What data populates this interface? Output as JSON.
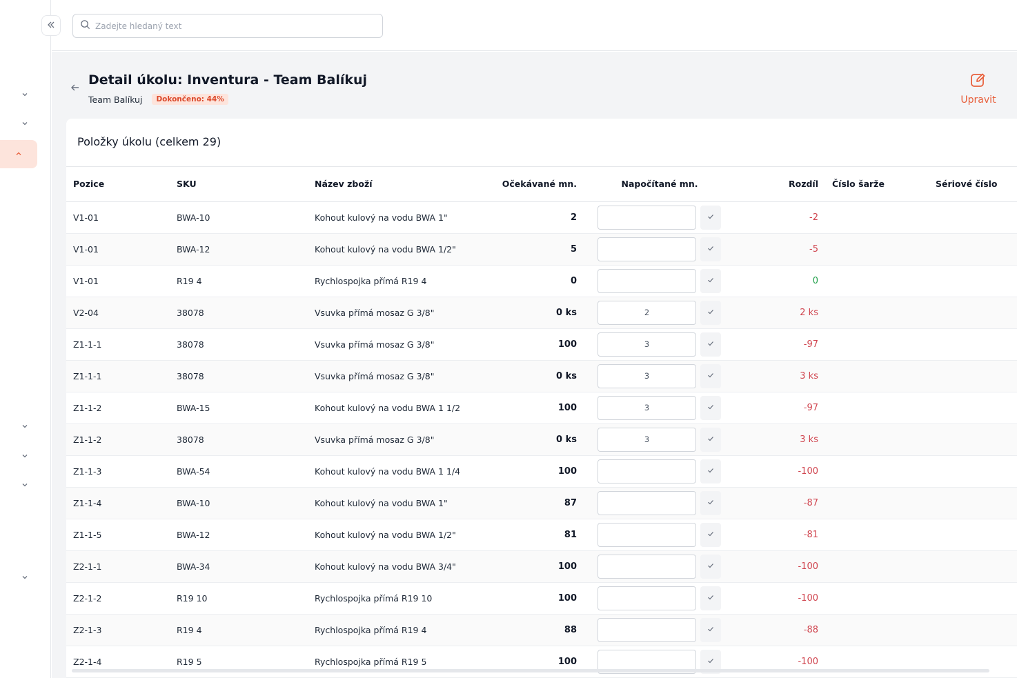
{
  "search": {
    "placeholder": "Zadejte hledaný text"
  },
  "page": {
    "title": "Detail úkolu: Inventura - Team Balíkuj",
    "team": "Team Balíkuj",
    "progress_badge": "Dokončeno: 44%",
    "edit_label": "Upravit"
  },
  "items_card": {
    "title": "Položky úkolu (celkem 29)"
  },
  "table": {
    "headers": {
      "position": "Pozice",
      "sku": "SKU",
      "name": "Název zboží",
      "expected": "Očekávané mn.",
      "counted": "Napočítané mn.",
      "diff": "Rozdíl",
      "batch": "Číslo šarže",
      "serial": "Sériové číslo"
    },
    "rows": [
      {
        "position": "V1-01",
        "sku": "BWA-10",
        "name": "Kohout kulový na vodu BWA 1\"",
        "expected": "2",
        "counted": "",
        "diff": "-2",
        "diff_status": "neg"
      },
      {
        "position": "V1-01",
        "sku": "BWA-12",
        "name": "Kohout kulový na vodu BWA 1/2\"",
        "expected": "5",
        "counted": "",
        "diff": "-5",
        "diff_status": "neg"
      },
      {
        "position": "V1-01",
        "sku": "R19 4",
        "name": "Rychlospojka přímá R19 4",
        "expected": "0",
        "counted": "",
        "diff": "0",
        "diff_status": "zero"
      },
      {
        "position": "V2-04",
        "sku": "38078",
        "name": "Vsuvka přímá mosaz G 3/8\"",
        "expected": "0 ks",
        "counted": "2",
        "diff": "2 ks",
        "diff_status": "neg"
      },
      {
        "position": "Z1-1-1",
        "sku": "38078",
        "name": "Vsuvka přímá mosaz G 3/8\"",
        "expected": "100",
        "counted": "3",
        "diff": "-97",
        "diff_status": "neg"
      },
      {
        "position": "Z1-1-1",
        "sku": "38078",
        "name": "Vsuvka přímá mosaz G 3/8\"",
        "expected": "0 ks",
        "counted": "3",
        "diff": "3 ks",
        "diff_status": "neg"
      },
      {
        "position": "Z1-1-2",
        "sku": "BWA-15",
        "name": "Kohout kulový na vodu BWA 1 1/2\"",
        "expected": "100",
        "counted": "3",
        "diff": "-97",
        "diff_status": "neg"
      },
      {
        "position": "Z1-1-2",
        "sku": "38078",
        "name": "Vsuvka přímá mosaz G 3/8\"",
        "expected": "0 ks",
        "counted": "3",
        "diff": "3 ks",
        "diff_status": "neg"
      },
      {
        "position": "Z1-1-3",
        "sku": "BWA-54",
        "name": "Kohout kulový na vodu BWA 1 1/4\"",
        "expected": "100",
        "counted": "",
        "diff": "-100",
        "diff_status": "neg"
      },
      {
        "position": "Z1-1-4",
        "sku": "BWA-10",
        "name": "Kohout kulový na vodu BWA 1\"",
        "expected": "87",
        "counted": "",
        "diff": "-87",
        "diff_status": "neg"
      },
      {
        "position": "Z1-1-5",
        "sku": "BWA-12",
        "name": "Kohout kulový na vodu BWA 1/2\"",
        "expected": "81",
        "counted": "",
        "diff": "-81",
        "diff_status": "neg"
      },
      {
        "position": "Z2-1-1",
        "sku": "BWA-34",
        "name": "Kohout kulový na vodu BWA 3/4\"",
        "expected": "100",
        "counted": "",
        "diff": "-100",
        "diff_status": "neg"
      },
      {
        "position": "Z2-1-2",
        "sku": "R19 10",
        "name": "Rychlospojka přímá R19 10",
        "expected": "100",
        "counted": "",
        "diff": "-100",
        "diff_status": "neg"
      },
      {
        "position": "Z2-1-3",
        "sku": "R19 4",
        "name": "Rychlospojka přímá R19 4",
        "expected": "88",
        "counted": "",
        "diff": "-88",
        "diff_status": "neg"
      },
      {
        "position": "Z2-1-4",
        "sku": "R19 5",
        "name": "Rychlospojka přímá R19 5",
        "expected": "100",
        "counted": "",
        "diff": "-100",
        "diff_status": "neg"
      }
    ]
  },
  "icons": {
    "collapse": "double-chevron-left-icon",
    "search": "search-icon",
    "back": "arrow-left-icon",
    "edit": "edit-icon",
    "check": "check-icon",
    "chevron": "chevron-down-icon"
  },
  "colors": {
    "accent": "#e8603c",
    "negative": "#d0454f",
    "positive": "#22a04b",
    "badge_bg": "#fde4dc"
  }
}
